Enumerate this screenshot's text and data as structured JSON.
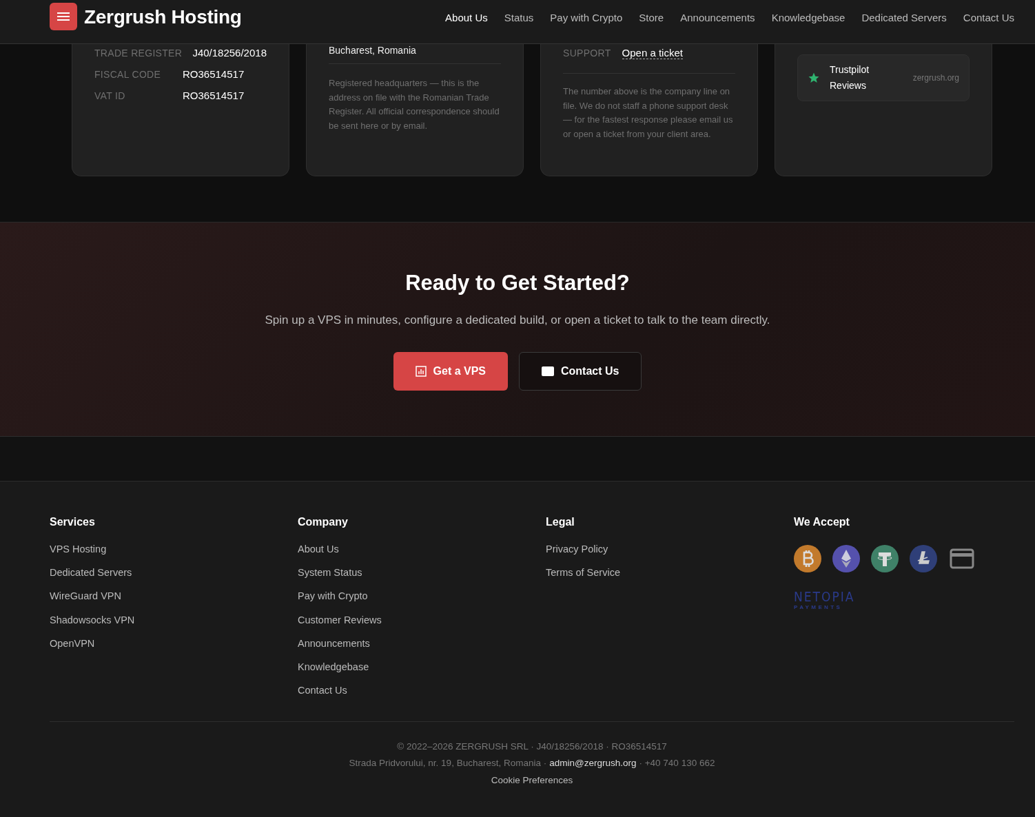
{
  "header": {
    "brand": "Zergrush Hosting",
    "nav": [
      {
        "label": "About Us",
        "selected": true
      },
      {
        "label": "Status",
        "selected": false
      },
      {
        "label": "Pay with Crypto",
        "selected": false
      },
      {
        "label": "Store",
        "selected": false
      },
      {
        "label": "Announcements",
        "selected": false
      },
      {
        "label": "Knowledgebase",
        "selected": false
      },
      {
        "label": "Dedicated Servers",
        "selected": false
      },
      {
        "label": "Contact Us",
        "selected": false
      }
    ]
  },
  "cards": [
    {
      "kind": "details",
      "rows": [
        {
          "label": "TRADE REGISTER",
          "value": "J40/18256/2018",
          "link": false
        },
        {
          "label": "FISCAL CODE",
          "value": "RO36514517",
          "link": false
        },
        {
          "label": "VAT ID",
          "value": "RO36514517",
          "link": false
        }
      ]
    },
    {
      "kind": "address",
      "address": "Bucharest, Romania",
      "note": "Registered headquarters — this is the address on file with the Romanian Trade Register. All official correspondence should be sent here or by email."
    },
    {
      "kind": "details",
      "rows": [
        {
          "label": "SUPPORT",
          "value": "Open a ticket",
          "link": true
        }
      ],
      "note": "The number above is the company line on file. We do not staff a phone support desk — for the fastest response please email us or open a ticket from your client area."
    },
    {
      "kind": "reviews",
      "reviews": [
        {
          "name": "Trustpilot Reviews",
          "site": "zergrush.org"
        }
      ]
    }
  ],
  "cta": {
    "title": "Ready to Get Started?",
    "text": "Spin up a VPS in minutes, configure a dedicated build, or open a ticket to talk to the team directly.",
    "buttons": [
      {
        "label": "Get a VPS",
        "kind": "primary"
      },
      {
        "label": "Contact Us",
        "kind": "outline"
      }
    ]
  },
  "footer": {
    "columns": [
      {
        "title": "Services",
        "links": [
          "VPS Hosting",
          "Dedicated Servers",
          "WireGuard VPN",
          "Shadowsocks VPN",
          "OpenVPN"
        ]
      },
      {
        "title": "Company",
        "links": [
          "About Us",
          "System Status",
          "Pay with Crypto",
          "Customer Reviews",
          "Announcements",
          "Knowledgebase",
          "Contact Us"
        ]
      },
      {
        "title": "Legal",
        "links": [
          "Privacy Policy",
          "Terms of Service"
        ]
      },
      {
        "title": "We Accept",
        "payments": [
          {
            "kind": "bitcoin",
            "color": "#c27a2c"
          },
          {
            "kind": "ethereum",
            "color": "#5551ad"
          },
          {
            "kind": "tether",
            "color": "#3f8168"
          },
          {
            "kind": "litecoin",
            "color": "#2f3f78"
          },
          {
            "kind": "card",
            "color": "#888888"
          }
        ],
        "logo": {
          "name": "NETOPIA",
          "tagline": "PAYMENTS"
        }
      }
    ],
    "copyright": "© 2022–2026 ZERGRUSH SRL · J40/18256/2018 · RO36514517",
    "address": "Strada Pridvorului, nr. 19, Bucharest, Romania ·",
    "email": "admin@zergrush.org",
    "phone": "· +40 740 130 662",
    "cookie": "Cookie Preferences"
  }
}
